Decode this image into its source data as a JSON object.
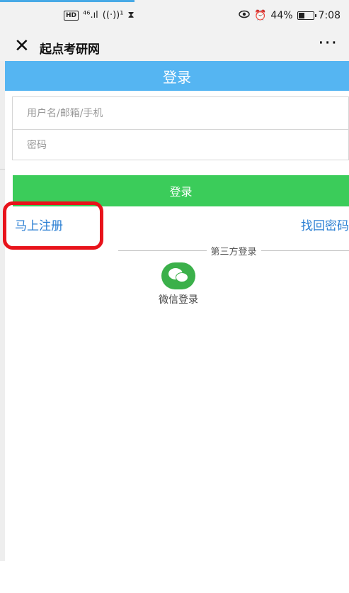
{
  "status_bar": {
    "hd": "HD",
    "network": "⁴⁶.ıl",
    "hotspot": "((·))¹",
    "hourglass": "⧗",
    "eye_icon": "eye-icon",
    "alarm": "⏰",
    "battery_text": "44%",
    "battery_level": 0.44,
    "time": "7:08"
  },
  "nav": {
    "close_symbol": "✕",
    "title": "起点考研网",
    "more_symbol": "···"
  },
  "header": {
    "title": "登录"
  },
  "form": {
    "username_placeholder": "用户名/邮箱/手机",
    "password_placeholder": "密码"
  },
  "login_button": {
    "label": "登录"
  },
  "links": {
    "register": "马上注册",
    "forgot": "找回密码"
  },
  "third_party": {
    "divider_text": "第三方登录",
    "wechat_label": "微信登录"
  },
  "colors": {
    "header_blue": "#55b5f2",
    "login_green": "#3bcc5a",
    "link_blue": "#2b7fd3",
    "highlight_red": "#e8131b",
    "wechat_green": "#3bb04a"
  }
}
